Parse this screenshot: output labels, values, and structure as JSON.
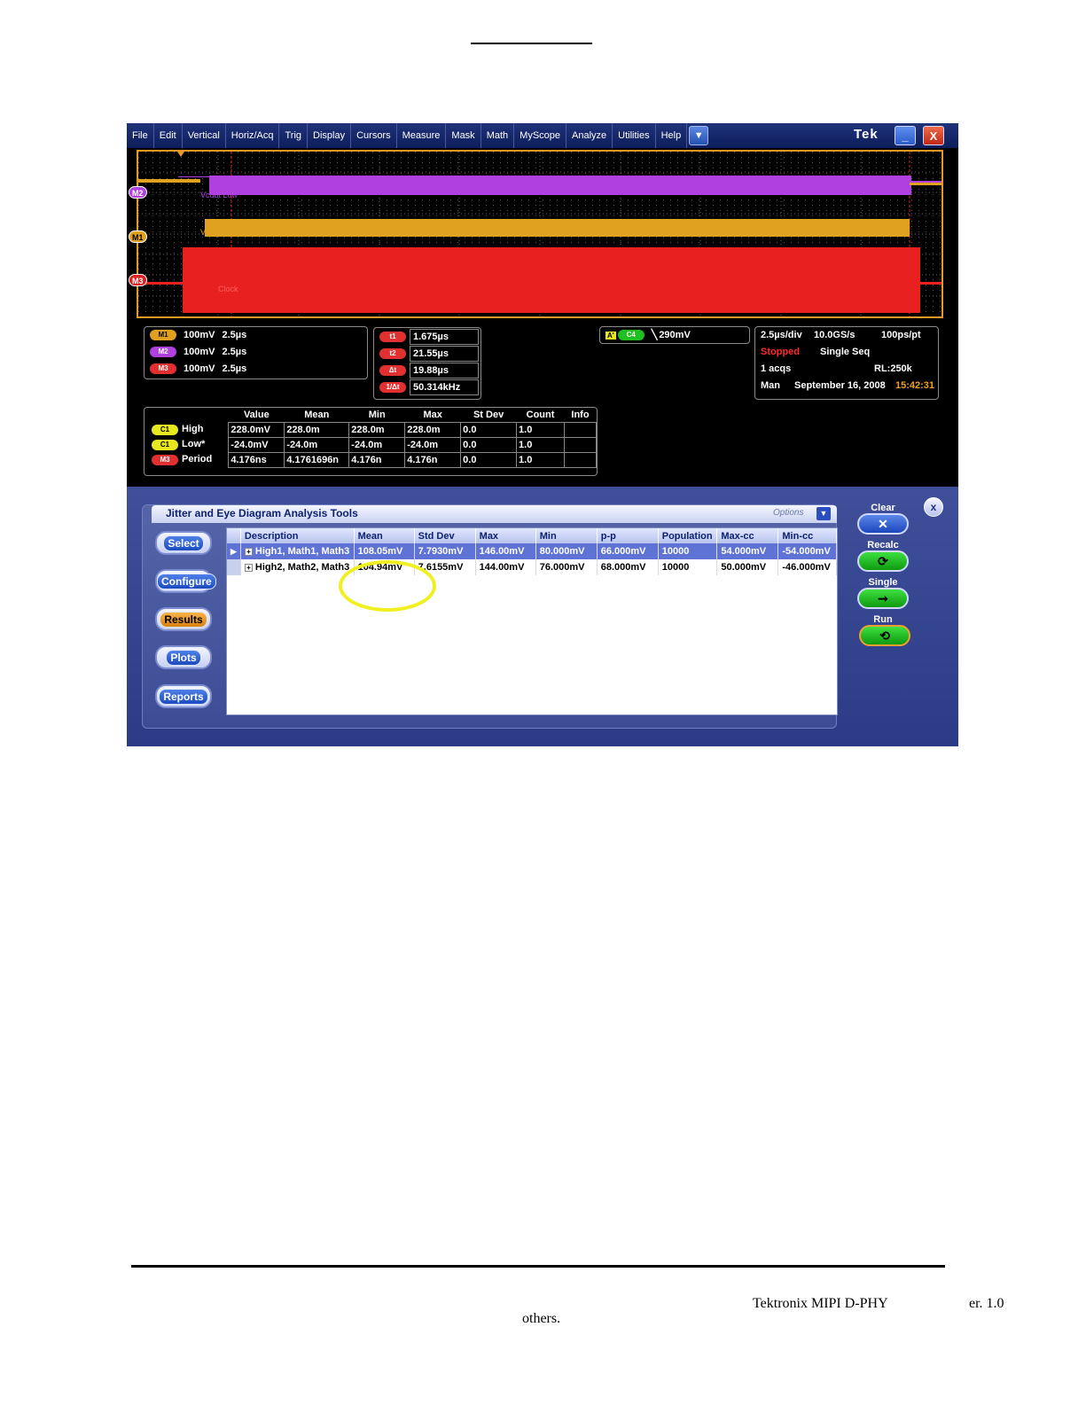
{
  "menu": [
    "File",
    "Edit",
    "Vertical",
    "Horiz/Acq",
    "Trig",
    "Display",
    "Cursors",
    "Measure",
    "Mask",
    "Math",
    "MyScope",
    "Analyze",
    "Utilities",
    "Help"
  ],
  "brand": "Tek",
  "window_buttons": {
    "minimize": "_",
    "close": "X"
  },
  "waveform": {
    "markers": {
      "m2": "M2",
      "m1": "M1",
      "m3": "M3"
    },
    "labels": {
      "m2": "Vcdbt Low",
      "m1": "Vcdbt High",
      "m3": "Clock"
    },
    "colors": {
      "m1": "#e0a020",
      "m2": "#b040e0",
      "m3": "#e82020",
      "border": "#e59a25"
    }
  },
  "channels": [
    {
      "tag": "M1",
      "scale": "100mV",
      "time": "2.5µs"
    },
    {
      "tag": "M2",
      "scale": "100mV",
      "time": "2.5µs"
    },
    {
      "tag": "M3",
      "scale": "100mV",
      "time": "2.5µs"
    }
  ],
  "cursors": [
    {
      "tag": "t1",
      "value": "1.675µs"
    },
    {
      "tag": "t2",
      "value": "21.55µs"
    },
    {
      "tag": "Δt",
      "value": "19.88µs"
    },
    {
      "tag": "1/Δt",
      "value": "50.314kHz"
    }
  ],
  "trigger": {
    "tag": "A'",
    "channel": "C4",
    "level": "290mV"
  },
  "timebase": {
    "scale": "2.5µs/div",
    "rate": "10.0GS/s",
    "resolution": "100ps/pt",
    "state": "Stopped",
    "mode": "Single Seq",
    "acqs": "1 acqs",
    "rl": "RL:250k",
    "trig_mode": "Man",
    "date": "September 16, 2008",
    "time": "15:42:31"
  },
  "measurements": {
    "headers": [
      "Value",
      "Mean",
      "Min",
      "Max",
      "St Dev",
      "Count",
      "Info"
    ],
    "rows": [
      {
        "tag": "C1",
        "label": "High",
        "cells": [
          "228.0mV",
          "228.0m",
          "228.0m",
          "228.0m",
          "0.0",
          "1.0",
          ""
        ]
      },
      {
        "tag": "C1",
        "label": "Low*",
        "cells": [
          "-24.0mV",
          "-24.0m",
          "-24.0m",
          "-24.0m",
          "0.0",
          "1.0",
          ""
        ]
      },
      {
        "tag": "M3",
        "label": "Period",
        "cells": [
          "4.176ns",
          "4.1761696n",
          "4.176n",
          "4.176n",
          "0.0",
          "1.0",
          ""
        ]
      }
    ]
  },
  "panel": {
    "title": "Jitter and Eye Diagram Analysis Tools",
    "options": "Options",
    "nav": [
      "Select",
      "Configure",
      "Results",
      "Plots",
      "Reports"
    ],
    "active_nav": "Results",
    "results": {
      "headers": [
        "Description",
        "Mean",
        "Std Dev",
        "Max",
        "Min",
        "p-p",
        "Population",
        "Max-cc",
        "Min-cc"
      ],
      "rows": [
        [
          "High1, Math1, Math3",
          "108.05mV",
          "7.7930mV",
          "146.00mV",
          "80.000mV",
          "66.000mV",
          "10000",
          "54.000mV",
          "-54.000mV"
        ],
        [
          "High2, Math2, Math3",
          "104.94mV",
          "7.6155mV",
          "144.00mV",
          "76.000mV",
          "68.000mV",
          "10000",
          "50.000mV",
          "-46.000mV"
        ]
      ]
    },
    "controls": {
      "clear": "Clear",
      "recalc": "Recalc",
      "single": "Single",
      "run": "Run"
    },
    "close": "x"
  },
  "footer": {
    "product": "Tektronix MIPI   D-PHY",
    "version": "er. 1.0",
    "others": "others."
  }
}
